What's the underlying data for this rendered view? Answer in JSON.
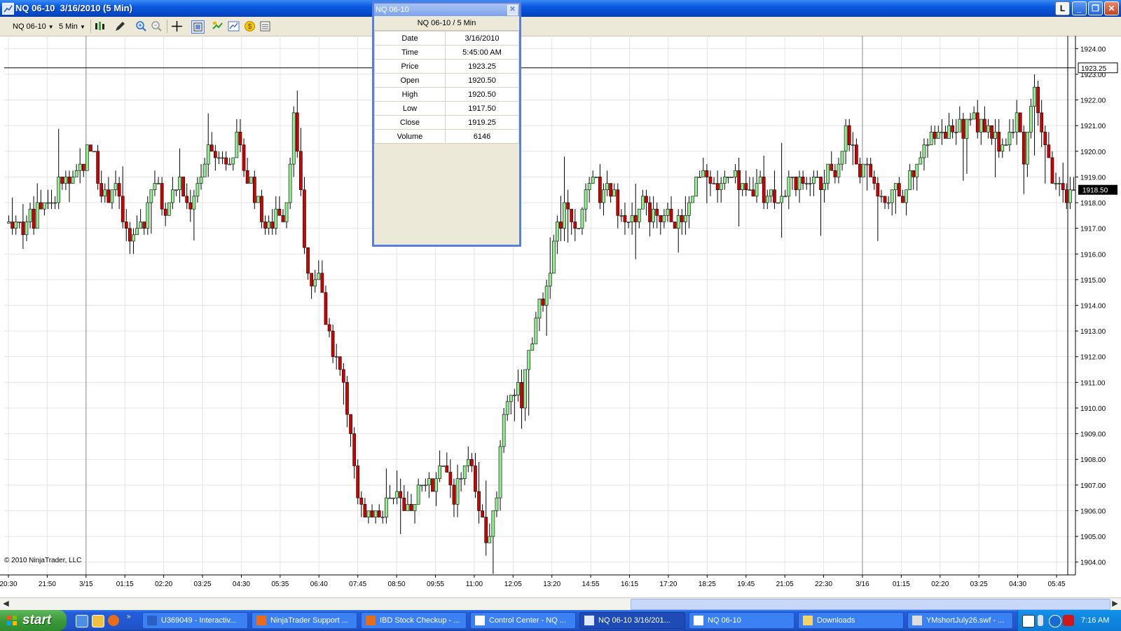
{
  "window": {
    "title": "NQ 06-10  3/16/2010 (5 Min)",
    "controls": [
      "L",
      "_",
      "❐",
      "✕"
    ]
  },
  "toolbar": {
    "instrument": "NQ 06-10",
    "interval": "5 Min",
    "icons": [
      "bar-type-icon",
      "drawing-tool-icon",
      "zoom-in-icon",
      "zoom-out-icon",
      "crosshair-icon",
      "data-box-icon",
      "instrument-list-icon",
      "chart-properties-icon",
      "order-entry-icon",
      "strategies-icon"
    ]
  },
  "databox": {
    "title": "NQ 06-10",
    "header": "NQ 06-10 / 5 Min",
    "rows": [
      {
        "label": "Date",
        "value": "3/16/2010"
      },
      {
        "label": "Time",
        "value": "5:45:00 AM"
      },
      {
        "label": "Price",
        "value": "1923.25"
      },
      {
        "label": "Open",
        "value": "1920.50"
      },
      {
        "label": "High",
        "value": "1920.50"
      },
      {
        "label": "Low",
        "value": "1917.50"
      },
      {
        "label": "Close",
        "value": "1919.25"
      },
      {
        "label": "Volume",
        "value": "6146"
      }
    ]
  },
  "chart": {
    "copyright": "© 2010 NinjaTrader, LLC",
    "crosshair_price": "1923.25",
    "last_price": "1918.50",
    "x_cursor_label": "05:45",
    "colors": {
      "up": "#90ee90",
      "down": "#d40000",
      "outline": "#000000",
      "grid": "#e4e4e4",
      "background": "#ffffff"
    }
  },
  "chart_data": {
    "type": "candlestick",
    "title": "",
    "ylim": [
      1903.5,
      1924.5
    ],
    "y_ticks": [
      "1904.00",
      "1905.00",
      "1906.00",
      "1907.00",
      "1908.00",
      "1909.00",
      "1910.00",
      "1911.00",
      "1912.00",
      "1913.00",
      "1914.00",
      "1915.00",
      "1916.00",
      "1917.00",
      "1918.00",
      "1919.00",
      "1920.00",
      "1921.00",
      "1922.00",
      "1923.00",
      "1924.00"
    ],
    "x_ticks": [
      "20:30",
      "21:50",
      "3/15",
      "01:15",
      "02:20",
      "03:25",
      "04:30",
      "05:35",
      "06:40",
      "07:45",
      "08:50",
      "09:55",
      "11:00",
      "12:05",
      "13:20",
      "14:55",
      "16:15",
      "17:20",
      "18:25",
      "19:45",
      "21:05",
      "22:30",
      "3/16",
      "01:15",
      "02:20",
      "03:25",
      "04:30",
      "05:45"
    ],
    "session_breaks": [
      "3/15",
      "3/16"
    ],
    "path": [
      1917.2,
      1916.9,
      1917.4,
      1917.2,
      1918.0,
      1917.8,
      1918.5,
      1919.0,
      1918.6,
      1919.6,
      1920.1,
      1919.2,
      1918.0,
      1919.0,
      1917.3,
      1916.2,
      1917.2,
      1917.5,
      1918.9,
      1917.8,
      1918.3,
      1918.8,
      1917.9,
      1918.6,
      1919.4,
      1920.4,
      1919.5,
      1920.0,
      1920.3,
      1919.3,
      1918.6,
      1917.6,
      1916.8,
      1918.0,
      1917.5,
      1921.4,
      1917.9,
      1914.4,
      1915.5,
      1913.5,
      1912.2,
      1911.0,
      1909.3,
      1906.7,
      1905.2,
      1906.4,
      1906.0,
      1907.0,
      1906.3,
      1905.7,
      1906.6,
      1907.4,
      1906.8,
      1907.8,
      1907.2,
      1906.5,
      1908.0,
      1907.5,
      1906.1,
      1904.4,
      1906.8,
      1910.3,
      1911.0,
      1910.2,
      1912.5,
      1913.6,
      1914.8,
      1916.2,
      1917.6,
      1917.8,
      1917.2,
      1918.1,
      1918.8,
      1918.2,
      1918.5,
      1918.0,
      1917.4,
      1917.1,
      1918.0,
      1917.6,
      1917.2,
      1917.5,
      1917.2,
      1917.1,
      1918.2,
      1918.8,
      1919.2,
      1918.6,
      1918.8,
      1919.0,
      1918.4,
      1918.3,
      1918.6,
      1918.5,
      1918.3,
      1918.5,
      1918.7,
      1919.0,
      1918.6,
      1918.9,
      1919.0,
      1919.3,
      1919.0,
      1921.0,
      1919.7,
      1919.3,
      1919.0,
      1918.3,
      1918.0,
      1918.2,
      1918.5,
      1918.8,
      1919.4,
      1920.3,
      1920.9,
      1921.1,
      1920.4,
      1920.8,
      1921.3,
      1921.2,
      1920.9,
      1920.6,
      1920.1,
      1920.5,
      1921.2,
      1919.8,
      1922.7,
      1920.6,
      1919.3,
      1918.4,
      1918.0,
      1918.5
    ]
  }
}
